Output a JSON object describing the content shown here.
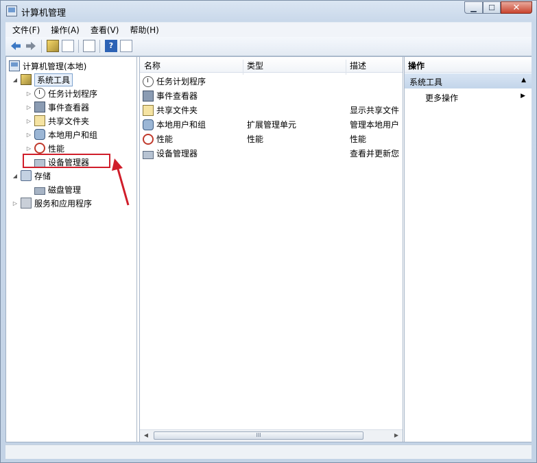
{
  "window": {
    "title": "计算机管理"
  },
  "menu": [
    "文件(F)",
    "操作(A)",
    "查看(V)",
    "帮助(H)"
  ],
  "tree": {
    "root": "计算机管理(本地)",
    "system_tools": "系统工具",
    "task_scheduler": "任务计划程序",
    "event_viewer": "事件查看器",
    "shared_folders": "共享文件夹",
    "local_users": "本地用户和组",
    "performance": "性能",
    "device_manager": "设备管理器",
    "storage": "存储",
    "disk_management": "磁盘管理",
    "services_apps": "服务和应用程序"
  },
  "list": {
    "headers": {
      "name": "名称",
      "type": "类型",
      "desc": "描述"
    },
    "rows": [
      {
        "name": "任务计划程序",
        "type": "",
        "desc": ""
      },
      {
        "name": "事件查看器",
        "type": "",
        "desc": ""
      },
      {
        "name": "共享文件夹",
        "type": "",
        "desc": "显示共享文件"
      },
      {
        "name": "本地用户和组",
        "type": "扩展管理单元",
        "desc": "管理本地用户"
      },
      {
        "name": "性能",
        "type": "性能",
        "desc": "性能"
      },
      {
        "name": "设备管理器",
        "type": "",
        "desc": "查看并更新您"
      }
    ],
    "scroll_thumb": "III"
  },
  "actions": {
    "header": "操作",
    "section": "系统工具",
    "more": "更多操作"
  },
  "colors": {
    "highlight": "#d01d2a",
    "selection": "#c3d5ea"
  }
}
